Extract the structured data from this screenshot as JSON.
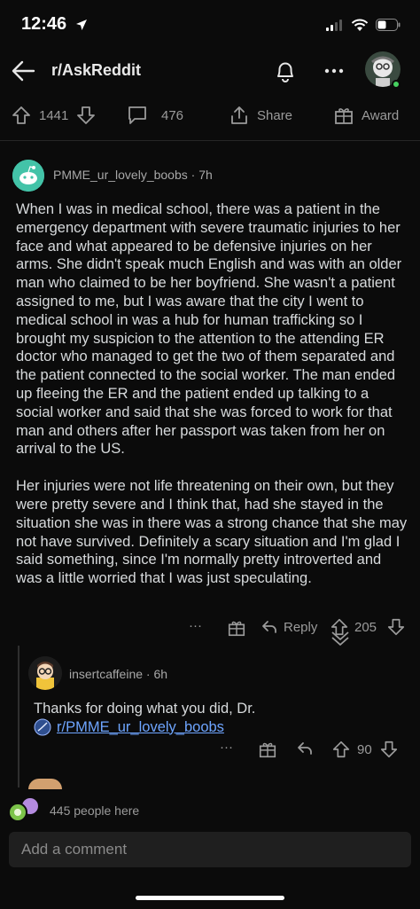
{
  "status": {
    "time": "12:46"
  },
  "header": {
    "subreddit": "r/AskReddit"
  },
  "post_actions": {
    "upvotes": "1441",
    "comments": "476",
    "share": "Share",
    "award": "Award"
  },
  "comment": {
    "username": "PMME_ur_lovely_boobs",
    "age": "· 7h",
    "paragraph1": "When I was in medical school, there was a patient in the emergency department with severe traumatic injuries to her face and what appeared to be defensive injuries on her arms. She didn't speak much English and was with an older man who claimed to be her boyfriend. She wasn't a patient assigned to me, but I was aware that the city I went to medical school in was a hub for human trafficking so I brought my suspicion to the attention to the attending ER doctor who managed to get the two of them separated and the patient connected to the social worker. The man ended up fleeing the ER and the patient ended up talking to a social worker and said that she was forced to work for that man and others after her passport was taken from her on arrival to the US.",
    "paragraph2": "Her injuries were not life threatening on their own, but they were pretty severe and I think that, had she stayed in the situation she was in there was a strong chance that she may not have survived. Definitely a scary situation and I'm glad I said something, since I'm normally pretty introverted and was a little worried that I was just speculating.",
    "more": "···",
    "reply": "Reply",
    "score": "205"
  },
  "reply": {
    "username": "insertcaffeine",
    "age": "· 6h",
    "text": "Thanks for doing what you did, Dr.",
    "link": "r/PMME_ur_lovely_boobs",
    "more": "···",
    "score": "90"
  },
  "footer": {
    "people_here": "445 people here",
    "comment_placeholder": "Add a comment"
  }
}
